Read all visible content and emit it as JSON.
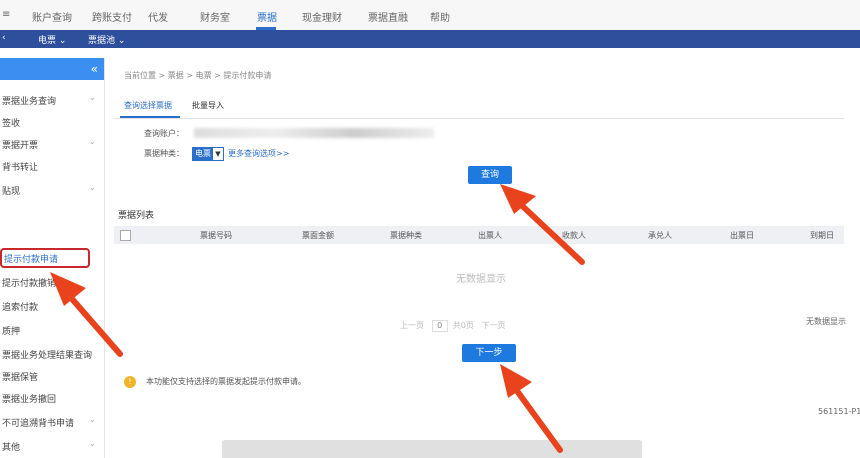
{
  "topnav": {
    "items": [
      "账户查询",
      "跨账支付",
      "代发",
      "财务室",
      "票据",
      "现金理财",
      "票据直融",
      "帮助"
    ],
    "active_index": 4
  },
  "subnav": {
    "items": [
      "电票 ⌄",
      "票据池 ⌄"
    ]
  },
  "sidebar": {
    "header_icon": "double-chevron-left-icon",
    "items": [
      "票据业务查询",
      "签收",
      "票据开票",
      "背书转让",
      "贴现",
      "提示付款申请",
      "提示付款撤销",
      "追索付款",
      "质押",
      "票据业务处理结果查询",
      "票据保管",
      "票据业务撤回",
      "不可追溯背书申请",
      "其他"
    ],
    "selected_index": 5
  },
  "breadcrumb": "当前位置 > 票据 > 电票 > 提示付款申请",
  "tabs": [
    "查询选择票据",
    "批量导入"
  ],
  "form": {
    "account_label": "查询账户：",
    "type_label": "票据种类：",
    "type_value": "电票",
    "more_link": "更多查询选项>>"
  },
  "query_button": "查询",
  "table": {
    "title": "票据列表",
    "columns": [
      "票据号码",
      "票面金额",
      "票据种类",
      "出票人",
      "收款人",
      "承兑人",
      "出票日",
      "到期日"
    ],
    "empty_text": "无数据显示"
  },
  "pager": {
    "prev": "上一页",
    "page": "0",
    "total": "共0页",
    "next": "下一页",
    "right_text": "无数据显示"
  },
  "next_button": "下一步",
  "info_text": "本功能仅支持选择的票据发起提示付款申请。",
  "footer_code": "561151-P1",
  "colors": {
    "accent": "#1f7ae0",
    "subnav": "#2e4f9c",
    "highlight": "#c8282c",
    "arrow": "#e8431c"
  }
}
